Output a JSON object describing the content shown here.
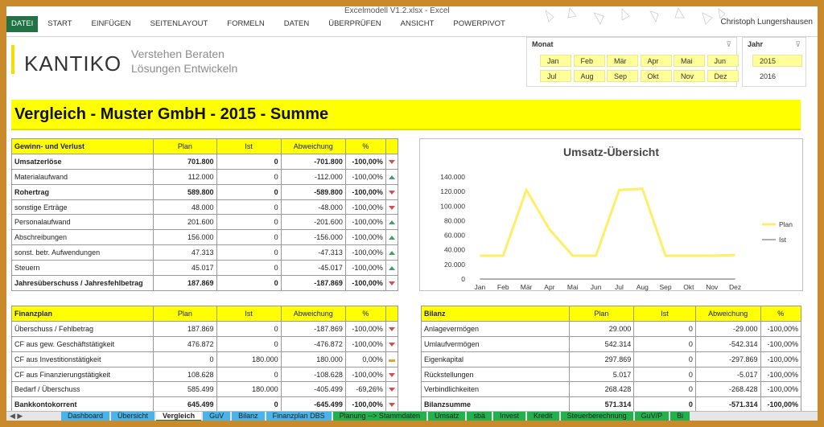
{
  "window": {
    "title": "Excelmodell V1.2.xlsx - Excel",
    "user": "Christoph Lungershausen"
  },
  "ribbon_tabs": [
    "DATEI",
    "START",
    "EINFÜGEN",
    "SEITENLAYOUT",
    "FORMELN",
    "DATEN",
    "ÜBERPRÜFEN",
    "ANSICHT",
    "POWERPIVOT"
  ],
  "logo": {
    "text": "KANTIKO",
    "slogan_line1": "Verstehen Beraten",
    "slogan_line2": "Lösungen Entwickeln"
  },
  "slicer_month": {
    "title": "Monat",
    "filter_icon": "filter-clear-icon",
    "months": [
      "Jan",
      "Feb",
      "Mär",
      "Apr",
      "Mai",
      "Jun",
      "Jul",
      "Aug",
      "Sep",
      "Okt",
      "Nov",
      "Dez"
    ]
  },
  "slicer_year": {
    "title": "Jahr",
    "filter_icon": "filter-clear-icon",
    "years": [
      "2015",
      "2016"
    ],
    "selected": "2015"
  },
  "banner": "Vergleich - Muster GmbH - 2015 - Summe",
  "guv": {
    "headers": [
      "Gewinn- und Verlust",
      "Plan",
      "Ist",
      "Abweichung",
      "%"
    ],
    "rows": [
      {
        "label": "Umsatzerlöse",
        "plan": "701.800",
        "ist": "0",
        "abw": "-701.800",
        "pct": "-100,00%",
        "trend": "down",
        "bold": true
      },
      {
        "label": "Materialaufwand",
        "plan": "112.000",
        "ist": "0",
        "abw": "-112.000",
        "pct": "-100,00%",
        "trend": "up",
        "bold": false
      },
      {
        "label": "Rohertrag",
        "plan": "589.800",
        "ist": "0",
        "abw": "-589.800",
        "pct": "-100,00%",
        "trend": "down",
        "bold": true
      },
      {
        "label": "sonstige Erträge",
        "plan": "48.000",
        "ist": "0",
        "abw": "-48.000",
        "pct": "-100,00%",
        "trend": "down",
        "bold": false
      },
      {
        "label": "Personalaufwand",
        "plan": "201.600",
        "ist": "0",
        "abw": "-201.600",
        "pct": "-100,00%",
        "trend": "up",
        "bold": false
      },
      {
        "label": "Abschreibungen",
        "plan": "156.000",
        "ist": "0",
        "abw": "-156.000",
        "pct": "-100,00%",
        "trend": "up",
        "bold": false
      },
      {
        "label": "sonst. betr. Aufwendungen",
        "plan": "47.313",
        "ist": "0",
        "abw": "-47.313",
        "pct": "-100,00%",
        "trend": "up",
        "bold": false
      },
      {
        "label": "Steuern",
        "plan": "45.017",
        "ist": "0",
        "abw": "-45.017",
        "pct": "-100,00%",
        "trend": "up",
        "bold": false
      },
      {
        "label": "Jahresüberschuss / Jahresfehlbetrag",
        "plan": "187.869",
        "ist": "0",
        "abw": "-187.869",
        "pct": "-100,00%",
        "trend": "down",
        "bold": true
      }
    ]
  },
  "finanzplan": {
    "headers": [
      "Finanzplan",
      "Plan",
      "Ist",
      "Abweichung",
      "%"
    ],
    "rows": [
      {
        "label": "Überschuss / Fehlbetrag",
        "plan": "187.869",
        "ist": "0",
        "abw": "-187.869",
        "pct": "-100,00%",
        "trend": "down",
        "bold": false
      },
      {
        "label": "CF aus gew. Geschäftstätigkeit",
        "plan": "476.872",
        "ist": "0",
        "abw": "-476.872",
        "pct": "-100,00%",
        "trend": "down",
        "bold": false
      },
      {
        "label": "CF aus Investitionstätigkeit",
        "plan": "0",
        "ist": "180.000",
        "abw": "180.000",
        "pct": "0,00%",
        "trend": "flat",
        "bold": false
      },
      {
        "label": "CF aus Finanzierungstätigkeit",
        "plan": "108.628",
        "ist": "0",
        "abw": "-108.628",
        "pct": "-100,00%",
        "trend": "down",
        "bold": false
      },
      {
        "label": "Bedarf / Überschuss",
        "plan": "585.499",
        "ist": "180.000",
        "abw": "-405.499",
        "pct": "-69,26%",
        "trend": "down",
        "bold": false
      },
      {
        "label": "Bankkontokorrent",
        "plan": "645.499",
        "ist": "0",
        "abw": "-645.499",
        "pct": "-100,00%",
        "trend": "down",
        "bold": true
      }
    ]
  },
  "bilanz": {
    "headers": [
      "Bilanz",
      "Plan",
      "Ist",
      "Abweichung",
      "%"
    ],
    "rows": [
      {
        "label": "Anlagevermögen",
        "plan": "29.000",
        "ist": "0",
        "abw": "-29.000",
        "pct": "-100,00%",
        "bold": false
      },
      {
        "label": "Umlaufvermögen",
        "plan": "542.314",
        "ist": "0",
        "abw": "-542.314",
        "pct": "-100,00%",
        "bold": false
      },
      {
        "label": "Eigenkapital",
        "plan": "297.869",
        "ist": "0",
        "abw": "-297.869",
        "pct": "-100,00%",
        "bold": false
      },
      {
        "label": "Rückstellungen",
        "plan": "5.017",
        "ist": "0",
        "abw": "-5.017",
        "pct": "-100,00%",
        "bold": false
      },
      {
        "label": "Verbindlichkeiten",
        "plan": "268.428",
        "ist": "0",
        "abw": "-268.428",
        "pct": "-100,00%",
        "bold": false
      },
      {
        "label": "Bilanzsumme",
        "plan": "571.314",
        "ist": "0",
        "abw": "-571.314",
        "pct": "-100,00%",
        "bold": true
      }
    ]
  },
  "chart_data": {
    "type": "line",
    "title": "Umsatz-Übersicht",
    "categories": [
      "Jan",
      "Feb",
      "Mär",
      "Apr",
      "Mai",
      "Jun",
      "Jul",
      "Aug",
      "Sep",
      "Okt",
      "Nov",
      "Dez"
    ],
    "series": [
      {
        "name": "Plan",
        "color": "#ffee66",
        "values": [
          32000,
          32000,
          122000,
          68000,
          32000,
          32000,
          122000,
          124000,
          32000,
          32000,
          32000,
          33000
        ]
      },
      {
        "name": "Ist",
        "color": "#7f7f7f",
        "values": [
          0,
          0,
          0,
          0,
          0,
          0,
          0,
          0,
          0,
          0,
          0,
          0
        ]
      }
    ],
    "yticks": [
      "140.000",
      "120.000",
      "100.000",
      "80.000",
      "60.000",
      "40.000",
      "20.000",
      "0"
    ],
    "ylim": [
      0,
      140000
    ],
    "legend": "right",
    "grid": false
  },
  "sheet_tabs": [
    "Dashboard",
    "Übersicht",
    "Vergleich",
    "GuV",
    "Bilanz",
    "Finanzplan DBS",
    "Planung --> Stammdaten",
    "Umsatz",
    "sbä",
    "Invest",
    "Kredit",
    "Steuerberechnung",
    "GuV/P",
    "Bi"
  ],
  "active_sheet": "Vergleich",
  "colors": {
    "accent_yellow": "#ffff00",
    "tab_green": "#22b14c",
    "tab_blue": "#4ab4e8",
    "file_green": "#217346"
  }
}
